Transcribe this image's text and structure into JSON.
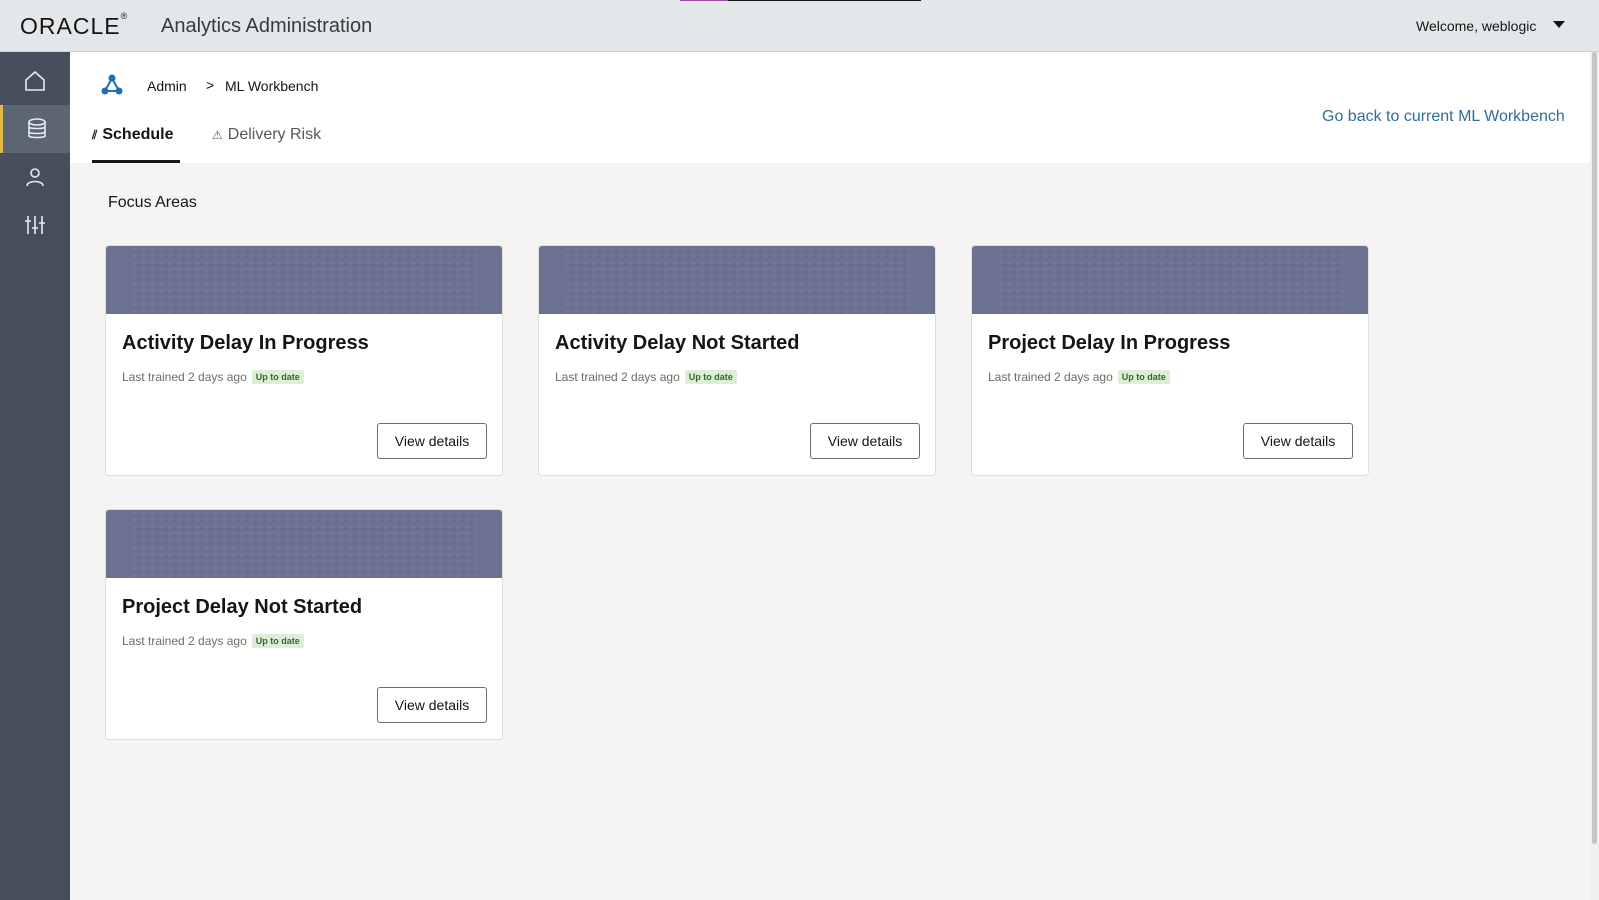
{
  "header": {
    "logo": "ORACLE",
    "logo_mark": "®",
    "app_title": "Analytics Administration",
    "welcome": "Welcome, weblogic"
  },
  "sidebar": {
    "items": [
      {
        "icon": "home-icon"
      },
      {
        "icon": "database-icon",
        "active": true
      },
      {
        "icon": "user-icon"
      },
      {
        "icon": "sliders-icon"
      }
    ]
  },
  "breadcrumb": {
    "root": "Admin",
    "separator": ">",
    "current": "ML Workbench"
  },
  "tabs": [
    {
      "label": "Schedule",
      "active": true
    },
    {
      "label": "Delivery Risk",
      "active": false
    }
  ],
  "go_back_link": "Go back to current ML Workbench",
  "section_title": "Focus Areas",
  "cards": [
    {
      "title": "Activity Delay In Progress",
      "meta": "Last trained 2 days ago",
      "badge": "Up to date",
      "button": "View details"
    },
    {
      "title": "Activity Delay Not Started",
      "meta": "Last trained 2 days ago",
      "badge": "Up to date",
      "button": "View details"
    },
    {
      "title": "Project Delay In Progress",
      "meta": "Last trained 2 days ago",
      "badge": "Up to date",
      "button": "View details"
    },
    {
      "title": "Project Delay Not Started",
      "meta": "Last trained 2 days ago",
      "badge": "Up to date",
      "button": "View details"
    }
  ],
  "colors": {
    "sidebar_bg": "#474f5c",
    "active_accent": "#e0b94a",
    "link": "#2f6f95",
    "card_banner": "#6b7190",
    "badge_bg": "#dcefd6"
  }
}
